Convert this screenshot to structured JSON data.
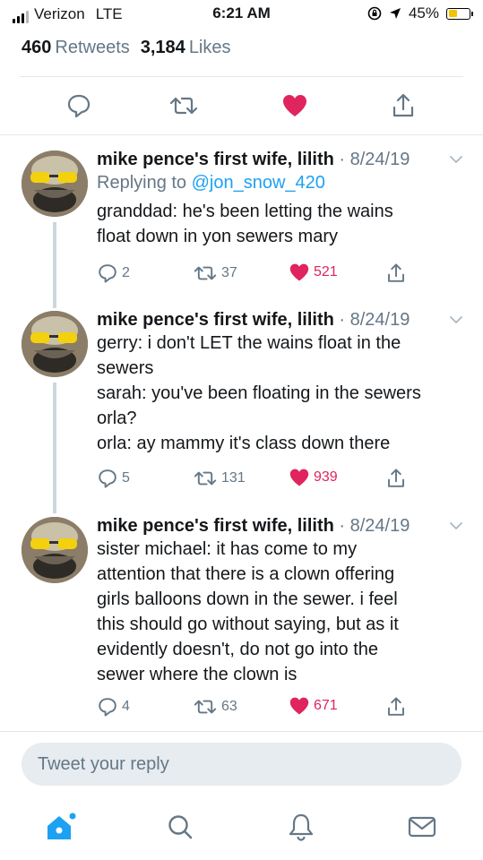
{
  "status_bar": {
    "carrier": "Verizon",
    "network": "LTE",
    "time": "6:21 AM",
    "battery_percent": "45%",
    "battery_level": 0.45
  },
  "stats": {
    "retweets_count": "460",
    "retweets_label": "Retweets",
    "likes_count": "3,184",
    "likes_label": "Likes"
  },
  "main_actions": [
    "reply-icon",
    "retweet-icon",
    "like-icon",
    "share-icon"
  ],
  "tweets": [
    {
      "name": "mike pence's first wife, lilith",
      "date": "8/24/19",
      "replying_to": "Replying to",
      "reply_handle": "@jon_snow_420",
      "text": "granddad: he's been letting the wains\nfloat down in yon sewers mary",
      "replies": "2",
      "retweets": "37",
      "likes": "521"
    },
    {
      "name": "mike pence's first wife, lilith",
      "date": "8/24/19",
      "text": "gerry: i don't LET the wains float in the\nsewers\nsarah: you've been floating in the sewers\norla?\norla: ay mammy it's class down there",
      "replies": "5",
      "retweets": "131",
      "likes": "939"
    },
    {
      "name": "mike pence's first wife, lilith",
      "date": "8/24/19",
      "text": "sister michael: it has come to my\nattention that there is a clown offering\ngirls balloons down in the sewer. i feel\nthis should go without saying, but as it\nevidently doesn't, do not go into the\nsewer where the clown is",
      "replies": "4",
      "retweets": "63",
      "likes": "671"
    }
  ],
  "reply_bar": {
    "placeholder": "Tweet your reply"
  },
  "tab_bar": [
    "home-icon",
    "search-icon",
    "notifications-icon",
    "messages-icon"
  ],
  "colors": {
    "accent": "#1da1f2",
    "like": "#e0245e",
    "muted": "#657786",
    "divider": "#e1e8ed"
  }
}
